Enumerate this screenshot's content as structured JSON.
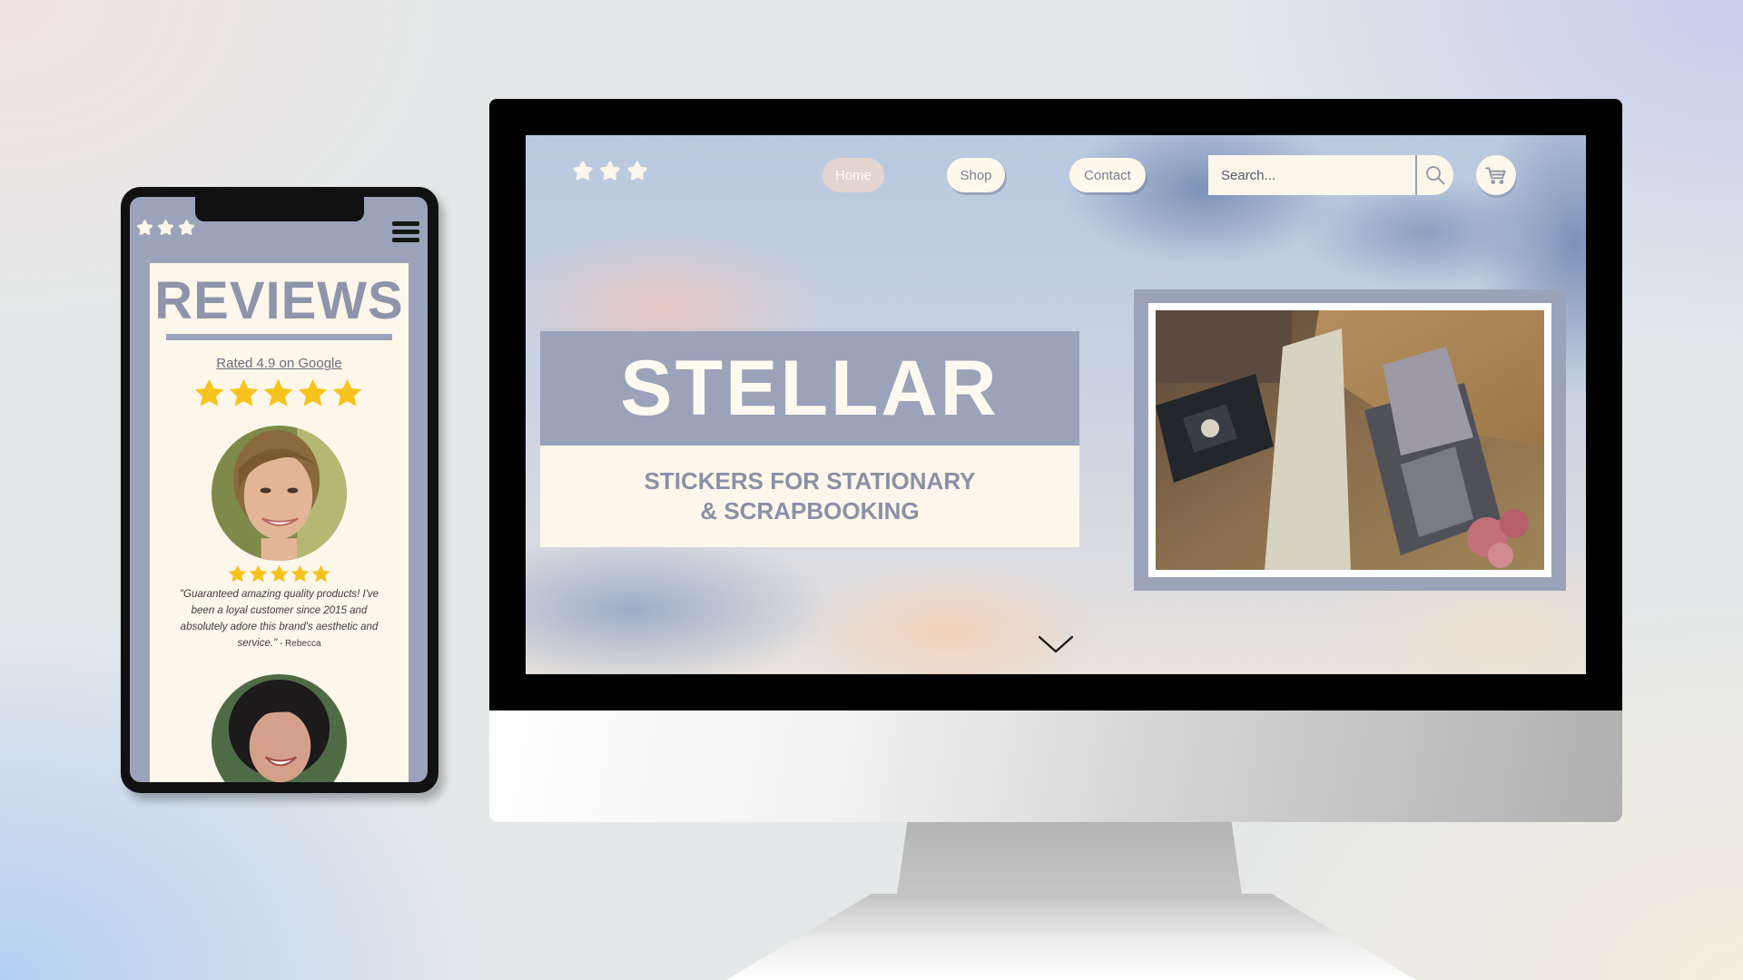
{
  "website": {
    "nav": {
      "home": "Home",
      "shop": "Shop",
      "contact": "Contact"
    },
    "search": {
      "placeholder": "Search..."
    },
    "hero": {
      "title": "STELLAR",
      "subtitle_line1": "STICKERS FOR STATIONARY",
      "subtitle_line2": "& SCRAPBOOKING"
    },
    "icons": {
      "logo": "three-stars-icon",
      "search": "search-icon",
      "cart": "cart-icon",
      "scroll": "chevron-down-icon"
    }
  },
  "mobile": {
    "heading": "REVIEWS",
    "rating_link": "Rated 4.9 on Google",
    "review": {
      "stars": 5,
      "quote": "\"Guaranteed amazing quality products! I've been a loyal customer since 2015 and absolutely adore this brand's aesthetic and service.\"",
      "author": " - Rebecca"
    },
    "icons": {
      "logo": "three-stars-icon",
      "menu": "hamburger-menu-icon"
    }
  },
  "colors": {
    "accent": "#9ba3ba",
    "cream": "#fdf6ea",
    "star_gold": "#f7c21a",
    "bezel": "#000000"
  }
}
